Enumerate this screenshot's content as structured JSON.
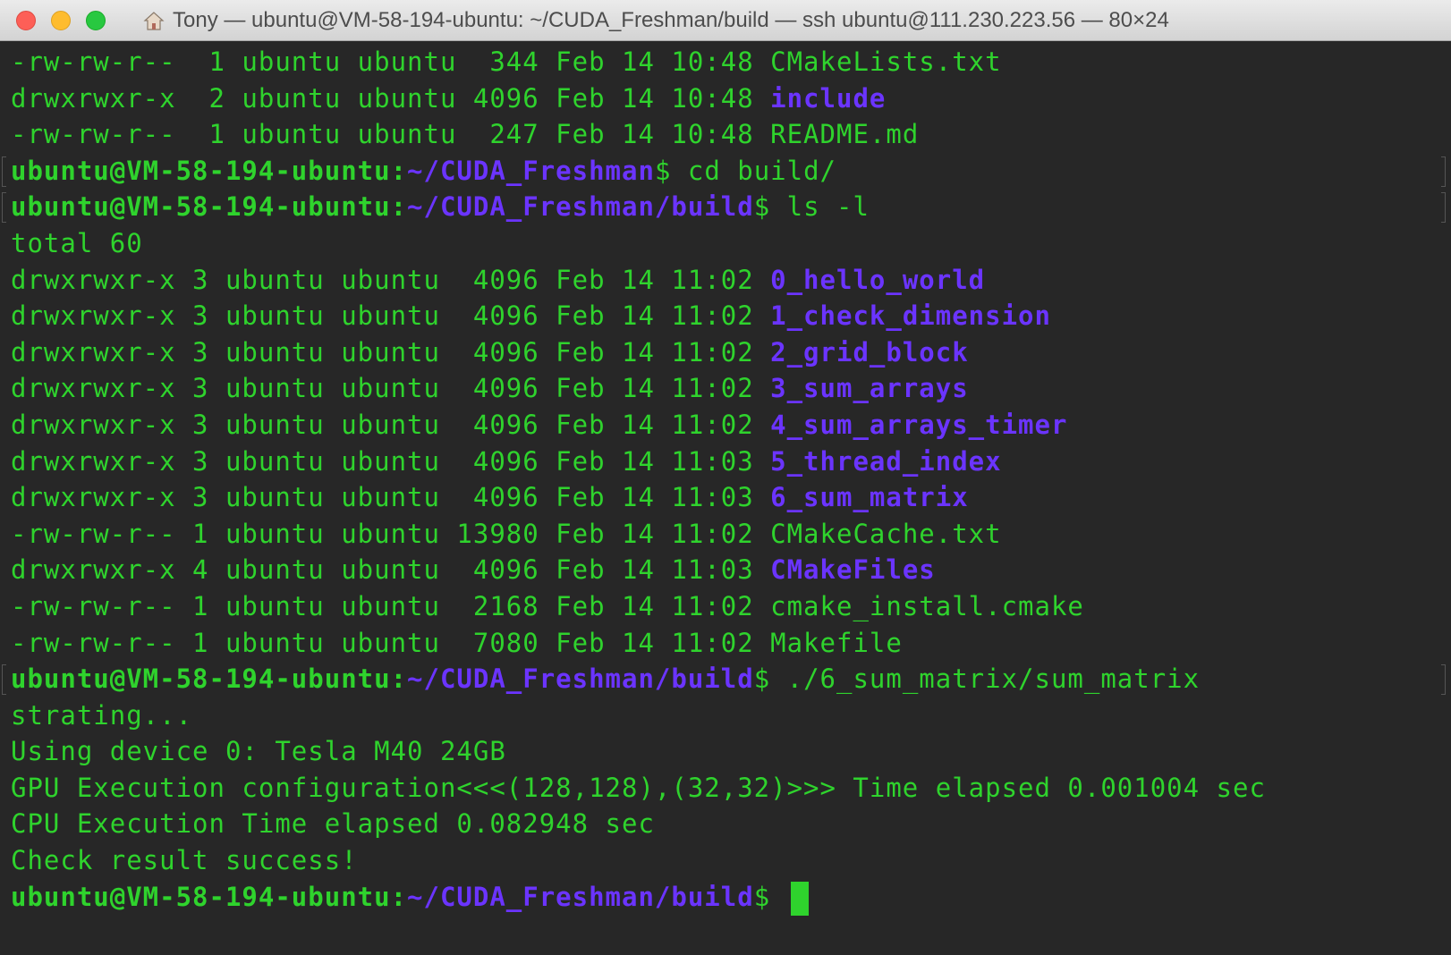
{
  "window": {
    "title": "Tony — ubuntu@VM-58-194-ubuntu: ~/CUDA_Freshman/build — ssh ubuntu@111.230.223.56 — 80×24",
    "title_icon": "home-icon"
  },
  "prompt": {
    "user": "ubuntu@VM-58-194-ubuntu:",
    "path_root": "~/CUDA_Freshman",
    "path_build": "~/CUDA_Freshman/build",
    "symbol": "$"
  },
  "listing1": [
    {
      "prefix": "-rw-rw-r--  1 ubuntu ubuntu  344 Feb 14 10:48 ",
      "name": "CMakeLists.txt",
      "is_dir": false
    },
    {
      "prefix": "drwxrwxr-x  2 ubuntu ubuntu 4096 Feb 14 10:48 ",
      "name": "include",
      "is_dir": true
    },
    {
      "prefix": "-rw-rw-r--  1 ubuntu ubuntu  247 Feb 14 10:48 ",
      "name": "README.md",
      "is_dir": false
    }
  ],
  "commands": {
    "cd": " cd build/",
    "ls": " ls -l",
    "run": " ./6_sum_matrix/sum_matrix"
  },
  "total_line": "total 60",
  "listing2": [
    {
      "prefix": "drwxrwxr-x 3 ubuntu ubuntu  4096 Feb 14 11:02 ",
      "name": "0_hello_world",
      "is_dir": true
    },
    {
      "prefix": "drwxrwxr-x 3 ubuntu ubuntu  4096 Feb 14 11:02 ",
      "name": "1_check_dimension",
      "is_dir": true
    },
    {
      "prefix": "drwxrwxr-x 3 ubuntu ubuntu  4096 Feb 14 11:02 ",
      "name": "2_grid_block",
      "is_dir": true
    },
    {
      "prefix": "drwxrwxr-x 3 ubuntu ubuntu  4096 Feb 14 11:02 ",
      "name": "3_sum_arrays",
      "is_dir": true
    },
    {
      "prefix": "drwxrwxr-x 3 ubuntu ubuntu  4096 Feb 14 11:02 ",
      "name": "4_sum_arrays_timer",
      "is_dir": true
    },
    {
      "prefix": "drwxrwxr-x 3 ubuntu ubuntu  4096 Feb 14 11:03 ",
      "name": "5_thread_index",
      "is_dir": true
    },
    {
      "prefix": "drwxrwxr-x 3 ubuntu ubuntu  4096 Feb 14 11:03 ",
      "name": "6_sum_matrix",
      "is_dir": true
    },
    {
      "prefix": "-rw-rw-r-- 1 ubuntu ubuntu 13980 Feb 14 11:02 ",
      "name": "CMakeCache.txt",
      "is_dir": false
    },
    {
      "prefix": "drwxrwxr-x 4 ubuntu ubuntu  4096 Feb 14 11:03 ",
      "name": "CMakeFiles",
      "is_dir": true
    },
    {
      "prefix": "-rw-rw-r-- 1 ubuntu ubuntu  2168 Feb 14 11:02 ",
      "name": "cmake_install.cmake",
      "is_dir": false
    },
    {
      "prefix": "-rw-rw-r-- 1 ubuntu ubuntu  7080 Feb 14 11:02 ",
      "name": "Makefile",
      "is_dir": false
    }
  ],
  "output": [
    "strating...",
    "Using device 0: Tesla M40 24GB",
    "GPU Execution configuration<<<(128,128),(32,32)>>> Time elapsed 0.001004 sec",
    "CPU Execution Time elapsed 0.082948 sec",
    "Check result success!"
  ],
  "colors": {
    "background": "#272727",
    "text_green": "#2fd32d",
    "dir_blue": "#6b34ff",
    "close": "#fd5f57",
    "minimize": "#febc2e",
    "maximize": "#28c840"
  }
}
